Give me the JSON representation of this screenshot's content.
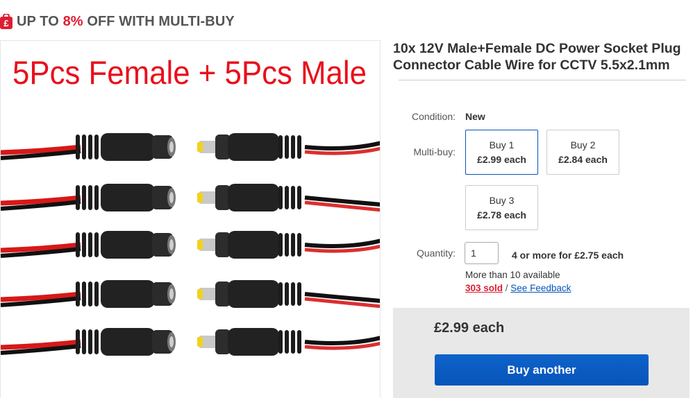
{
  "promo": {
    "prefix": "UP TO ",
    "percent": "8%",
    "suffix": " OFF WITH MULTI-BUY",
    "accent": "#dd1e31"
  },
  "gallery": {
    "caption": "5Pcs Female + 5Pcs Male"
  },
  "listing": {
    "title": "10x 12V Male+Female DC Power Socket Plug Connector Cable Wire for CCTV 5.5x2.1mm"
  },
  "condition": {
    "label": "Condition:",
    "value": "New"
  },
  "multibuy": {
    "label": "Multi-buy:",
    "options": [
      {
        "qty": "Buy 1",
        "price": "£2.99 each",
        "selected": true
      },
      {
        "qty": "Buy 2",
        "price": "£2.84 each",
        "selected": false
      },
      {
        "qty": "Buy 3",
        "price": "£2.78 each",
        "selected": false
      }
    ]
  },
  "quantity": {
    "label": "Quantity:",
    "value": "1",
    "bulk_offer": "4 or more for £2.75 each",
    "availability": "More than 10 available",
    "sold": "303 sold",
    "separator": " / ",
    "feedback": "See Feedback"
  },
  "buybox": {
    "price": "£2.99 each",
    "button": "Buy another",
    "button_color": "#0654ba"
  }
}
